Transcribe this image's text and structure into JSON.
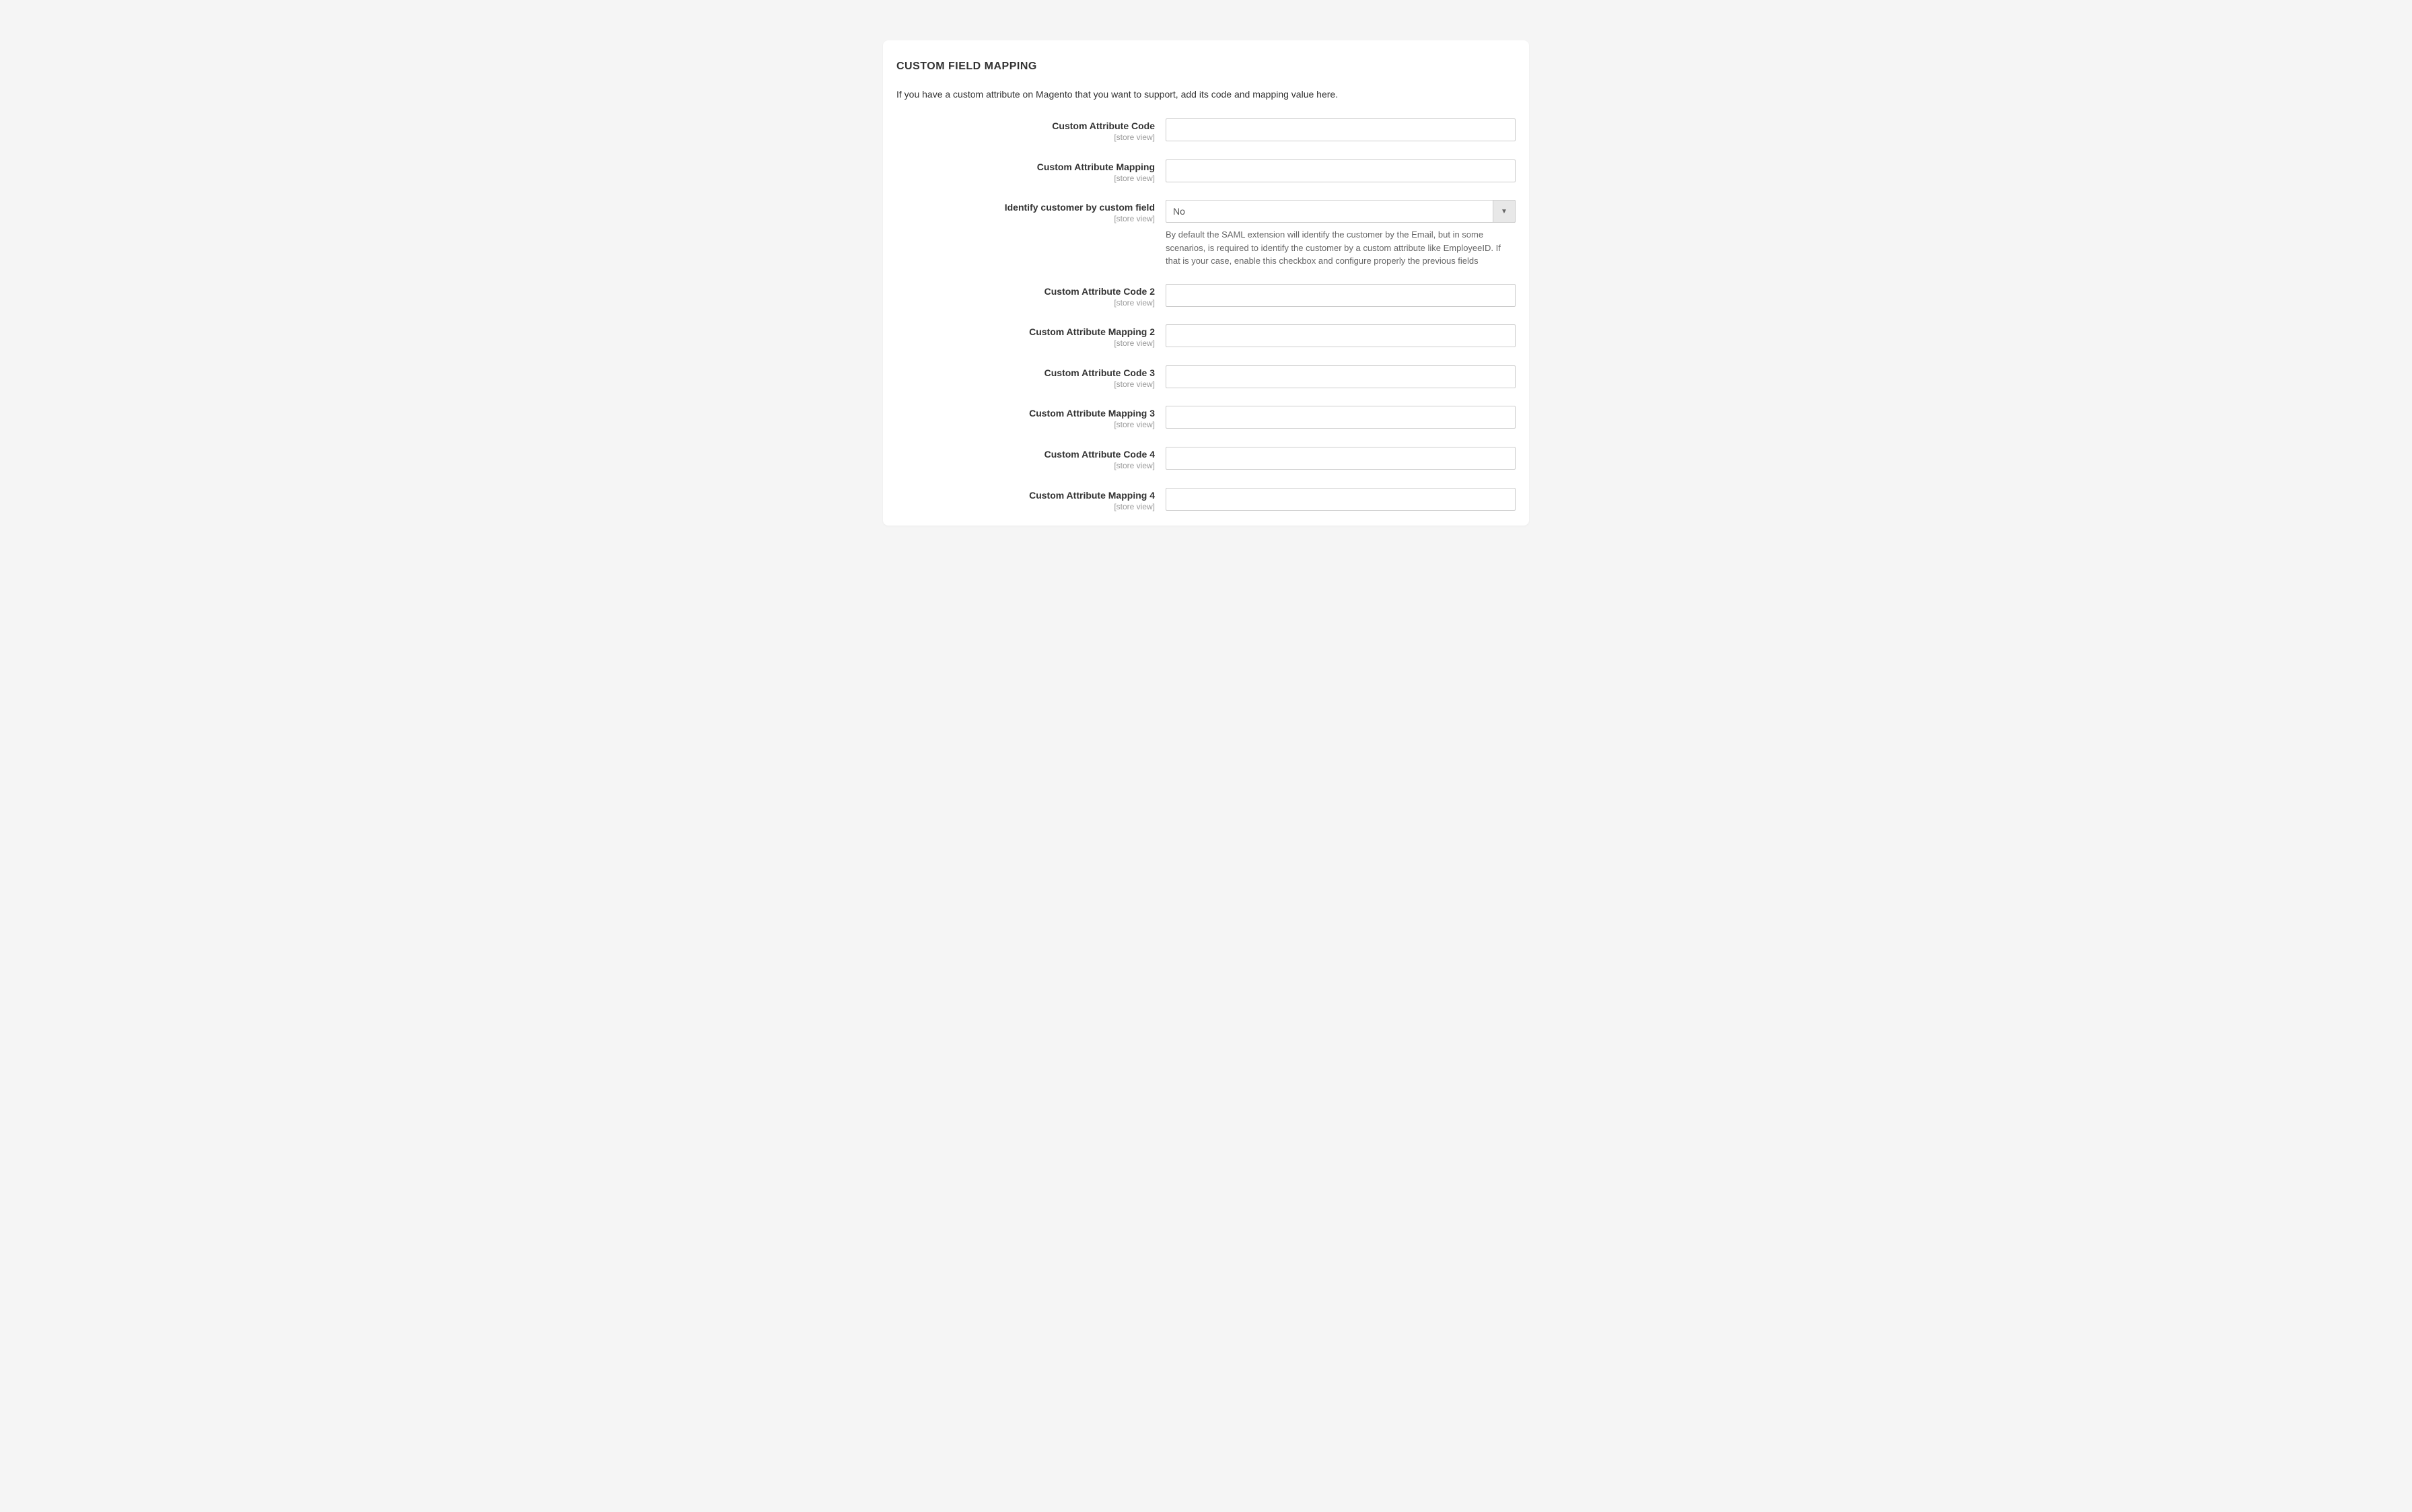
{
  "section": {
    "title": "CUSTOM FIELD MAPPING",
    "description": "If you have a custom attribute on Magento that you want to support, add its code and mapping value here."
  },
  "scope_label": "[store view]",
  "fields": {
    "custom_attr_code": {
      "label": "Custom Attribute Code",
      "value": ""
    },
    "custom_attr_mapping": {
      "label": "Custom Attribute Mapping",
      "value": ""
    },
    "identify_by_custom": {
      "label": "Identify customer by custom field",
      "value": "No",
      "help": "By default the SAML extension will identify the customer by the Email, but in some scenarios, is required to identify the customer by a custom attribute like EmployeeID. If that is your case, enable this checkbox and configure properly the previous fields"
    },
    "custom_attr_code_2": {
      "label": "Custom Attribute Code 2",
      "value": ""
    },
    "custom_attr_mapping_2": {
      "label": "Custom Attribute Mapping 2",
      "value": ""
    },
    "custom_attr_code_3": {
      "label": "Custom Attribute Code 3",
      "value": ""
    },
    "custom_attr_mapping_3": {
      "label": "Custom Attribute Mapping 3",
      "value": ""
    },
    "custom_attr_code_4": {
      "label": "Custom Attribute Code 4",
      "value": ""
    },
    "custom_attr_mapping_4": {
      "label": "Custom Attribute Mapping 4",
      "value": ""
    }
  }
}
